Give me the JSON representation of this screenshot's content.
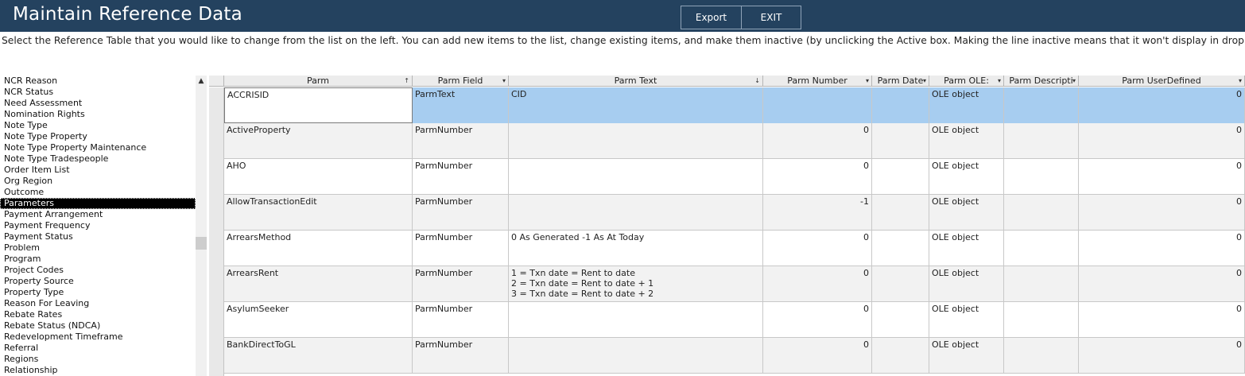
{
  "header": {
    "title": "Maintain Reference Data",
    "export_label": "Export",
    "exit_label": "EXIT"
  },
  "instructions": "Select the Reference Table that you would like to change from the list on the left. You can add new items to the list, change existing items, and make them inactive (by unclicking the Active box. Making the line inactive means that it won't display in drop down lists.",
  "reference_tables": [
    "NCR Reason",
    "NCR Status",
    "Need Assessment",
    "Nomination Rights",
    "Note Type",
    "Note Type Property",
    "Note Type Property Maintenance",
    "Note Type Tradespeople",
    "Order Item List",
    "Org Region",
    "Outcome",
    "Parameters",
    "Payment Arrangement",
    "Payment Frequency",
    "Payment Status",
    "Problem",
    "Program",
    "Project Codes",
    "Property Source",
    "Property Type",
    "Reason For Leaving",
    "Rebate Rates",
    "Rebate Status (NDCA)",
    "Redevelopment Timeframe",
    "Referral",
    "Regions",
    "Relationship"
  ],
  "selected_table": "Parameters",
  "grid": {
    "columns": [
      {
        "label": "Parm",
        "sort": "↑"
      },
      {
        "label": "Parm Field",
        "sort": "▾"
      },
      {
        "label": "Parm Text",
        "sort": "↓"
      },
      {
        "label": "Parm Number",
        "sort": "▾"
      },
      {
        "label": "Parm Date",
        "sort": "▾"
      },
      {
        "label": "Parm OLE:",
        "sort": "▾"
      },
      {
        "label": "Parm Descripti",
        "sort": "▾"
      },
      {
        "label": "Parm UserDefined",
        "sort": "▾"
      }
    ],
    "rows": [
      [
        "ACCRISID",
        "ParmText",
        "CID",
        "",
        "",
        "OLE object",
        "",
        "0"
      ],
      [
        "ActiveProperty",
        "ParmNumber",
        "",
        "0",
        "",
        "OLE object",
        "",
        "0"
      ],
      [
        "AHO",
        "ParmNumber",
        "",
        "0",
        "",
        "OLE object",
        "",
        "0"
      ],
      [
        "AllowTransactionEdit",
        "ParmNumber",
        "",
        "-1",
        "",
        "OLE object",
        "",
        "0"
      ],
      [
        "ArrearsMethod",
        "ParmNumber",
        "0 As Generated -1 As At Today",
        "0",
        "",
        "OLE object",
        "",
        "0"
      ],
      [
        "ArrearsRent",
        "ParmNumber",
        "1 = Txn date = Rent to date\n2 = Txn date = Rent to date + 1\n3 = Txn date = Rent to date + 2",
        "0",
        "",
        "OLE object",
        "",
        "0"
      ],
      [
        "AsylumSeeker",
        "ParmNumber",
        "",
        "0",
        "",
        "OLE object",
        "",
        "0"
      ],
      [
        "BankDirectToGL",
        "ParmNumber",
        "",
        "0",
        "",
        "OLE object",
        "",
        "0"
      ]
    ]
  },
  "colors": {
    "titlebar": "#24425f",
    "selected_row": "#a7cdf0"
  }
}
